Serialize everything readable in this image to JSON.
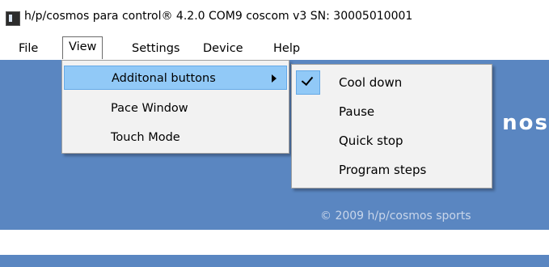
{
  "window": {
    "title": "h/p/cosmos para control® 4.2.0 COM9 coscom v3  SN: 30005010001",
    "icon": "app-icon"
  },
  "menubar": {
    "items": [
      "File",
      "View",
      "Settings",
      "Device",
      "Help"
    ],
    "active": "View"
  },
  "view_menu": {
    "items": [
      {
        "label": "Additonal buttons",
        "has_submenu": true,
        "highlighted": true
      },
      {
        "label": "Pace Window"
      },
      {
        "label": "Touch Mode"
      }
    ]
  },
  "submenu": {
    "items": [
      {
        "label": "Cool down",
        "checked": true
      },
      {
        "label": "Pause"
      },
      {
        "label": "Quick stop"
      },
      {
        "label": "Program steps"
      }
    ]
  },
  "banner": {
    "partial_text": "nos",
    "copyright": "© 2009 h/p/cosmos sports"
  },
  "colors": {
    "banner_blue": "#5a86c1",
    "menu_background": "#f2f2f2",
    "highlight": "#91c9f7",
    "highlight_border": "#65a9e6"
  }
}
